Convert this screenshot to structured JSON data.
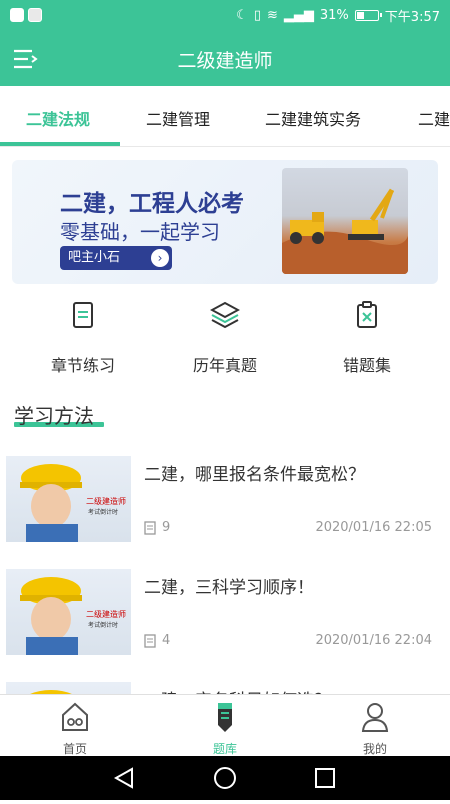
{
  "status": {
    "battery_pct": "31%",
    "time": "下午3:57",
    "battery_level": 0.31
  },
  "header": {
    "title": "二级建造师"
  },
  "tabs": [
    {
      "label": "二建法规"
    },
    {
      "label": "二建管理"
    },
    {
      "label": "二建建筑实务"
    },
    {
      "label": "二建"
    }
  ],
  "banner": {
    "headline": "二建，工程人必考",
    "subline": "零基础，一起学习",
    "button": "吧主小石"
  },
  "quick_actions": [
    {
      "label": "章节练习",
      "icon": "chapter-doc-icon"
    },
    {
      "label": "历年真题",
      "icon": "layers-icon"
    },
    {
      "label": "错题集",
      "icon": "clipboard-x-icon"
    }
  ],
  "section": {
    "title": "学习方法"
  },
  "articles": [
    {
      "title": "二建，哪里报名条件最宽松？",
      "count": "9",
      "date": "2020/01/16 22:05",
      "thumb_text_1": "二级建造师",
      "thumb_text_2": "考试倒计时"
    },
    {
      "title": "二建，三科学习顺序！",
      "count": "4",
      "date": "2020/01/16 22:04",
      "thumb_text_1": "二级建造师",
      "thumb_text_2": "考试倒计时"
    },
    {
      "title": "二建，实务科目如何选？",
      "count": "",
      "date": "",
      "thumb_text_1": "",
      "thumb_text_2": ""
    }
  ],
  "bottom_nav": [
    {
      "label": "首页",
      "icon": "home-icon"
    },
    {
      "label": "题库",
      "icon": "pen-bank-icon"
    },
    {
      "label": "我的",
      "icon": "user-icon"
    }
  ],
  "colors": {
    "accent": "#3cc497",
    "banner_text": "#2d3f93"
  }
}
